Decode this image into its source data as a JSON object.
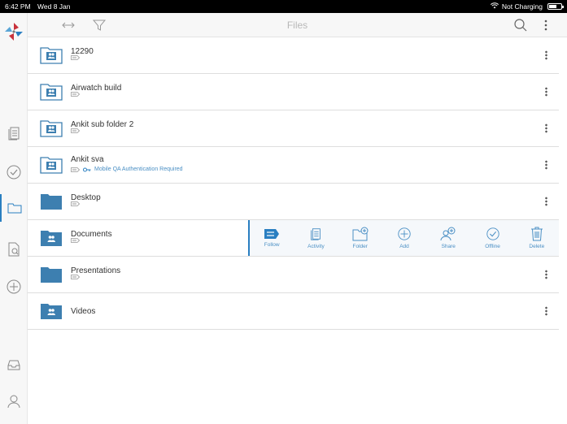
{
  "status_bar": {
    "time": "6:42 PM",
    "date": "Wed 8 Jan",
    "charging": "Not Charging"
  },
  "header": {
    "title": "Files"
  },
  "rows": [
    {
      "name": "12290",
      "detail": ""
    },
    {
      "name": "Airwatch build",
      "detail": ""
    },
    {
      "name": "Ankit sub folder 2",
      "detail": ""
    },
    {
      "name": "Ankit sva",
      "detail": "Mobile QA Authentication Required"
    },
    {
      "name": "Desktop",
      "detail": ""
    },
    {
      "name": "Documents",
      "detail": ""
    },
    {
      "name": "Presentations",
      "detail": ""
    },
    {
      "name": "Videos",
      "detail": ""
    }
  ],
  "row_actions": [
    "Follow",
    "Activity",
    "Folder",
    "Add",
    "Share",
    "Offline",
    "Delete"
  ],
  "colors": {
    "accent": "#2a7fc1",
    "folder": "#3d7fb0",
    "icon_gray": "#888888"
  }
}
